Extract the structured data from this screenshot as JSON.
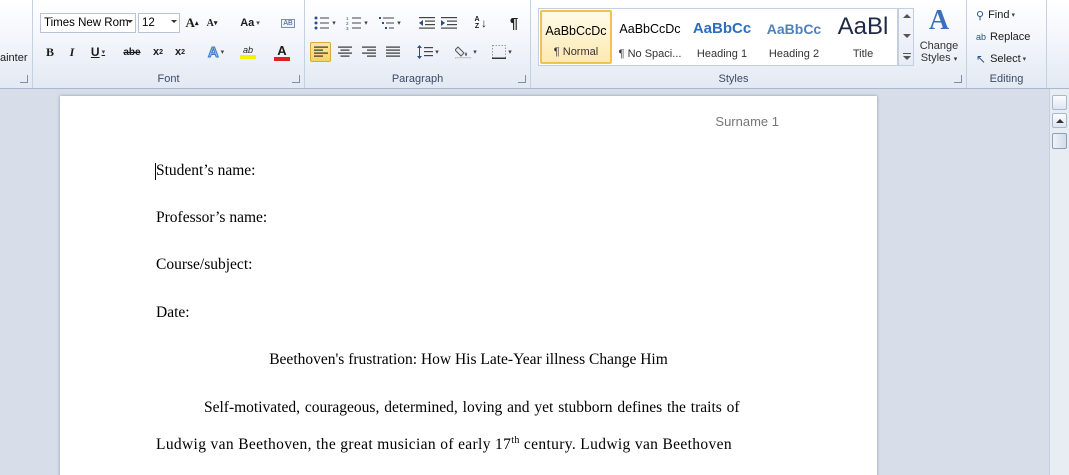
{
  "clipboard": {
    "format_painter_partial": "ainter"
  },
  "font": {
    "group_label": "Font",
    "name": "Times New Rom",
    "size": "12",
    "grow_label": "A",
    "shrink_label": "A",
    "change_case_label": "Aa",
    "bold": "B",
    "italic": "I",
    "underline": "U",
    "strike": "abe",
    "subscript": "x",
    "superscript": "x",
    "sub_mark": "2",
    "sup_mark": "2",
    "highlight_label": "ab",
    "font_color_label": "A",
    "clear_label": "AB"
  },
  "paragraph": {
    "group_label": "Paragraph",
    "pilcrow": "¶",
    "sort_label": "A Z"
  },
  "styles": {
    "group_label": "Styles",
    "items": [
      {
        "preview": "AaBbCcDc",
        "name": "¶ Normal"
      },
      {
        "preview": "AaBbCcDc",
        "name": "¶ No Spaci..."
      },
      {
        "preview": "AaBbCc",
        "name": "Heading 1"
      },
      {
        "preview": "AaBbCc",
        "name": "Heading 2"
      },
      {
        "preview": "AaBl",
        "name": "Title"
      }
    ],
    "change_styles_line1": "Change",
    "change_styles_line2": "Styles"
  },
  "editing": {
    "group_label": "Editing",
    "find": "Find",
    "replace": "Replace",
    "select": "Select",
    "replace_icon_text": "ab"
  },
  "colors": {
    "highlight": "#f4f000",
    "font_color": "#e0201c",
    "heading1": "#2e6fbd",
    "heading2": "#4f81bd",
    "accent_active": "#f2c24c"
  },
  "document": {
    "header": "Surname 1",
    "lines": {
      "student": "Student’s name:",
      "professor": "Professor’s name:",
      "course": "Course/subject:",
      "date": "Date:",
      "title": "Beethoven's frustration: How His Late-Year illness Change Him",
      "para1": "Self-motivated, courageous,  determined, loving and yet stubborn defines the traits of",
      "para2_before": "Ludwig van Beethoven, the great musician of early 17",
      "para2_sup": "th",
      "para2_after": " century. Ludwig van Beethoven"
    }
  }
}
